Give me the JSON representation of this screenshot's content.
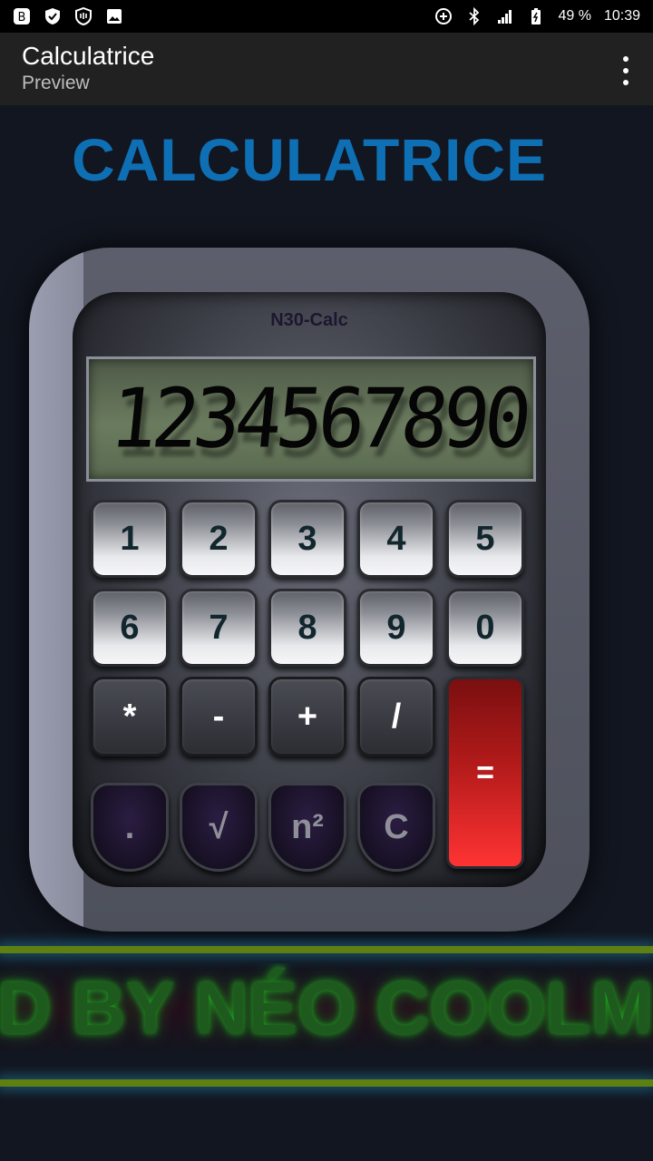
{
  "status_bar": {
    "left_icons": [
      "bitcoin-icon",
      "shield-icon",
      "vpn-shield-icon",
      "image-icon"
    ],
    "right_icons": [
      "data-saver-icon",
      "bluetooth-icon",
      "signal-icon",
      "battery-icon"
    ],
    "battery": "49 %",
    "time": "10:39"
  },
  "app_bar": {
    "title": "Calculatrice",
    "subtitle": "Preview",
    "menu_icon": "more-vert-icon"
  },
  "heading": "CALCULATRICE",
  "calculator": {
    "brand": "N30-Calc",
    "display": "1234567890",
    "keys_row1": [
      "1",
      "2",
      "3",
      "4",
      "5"
    ],
    "keys_row2": [
      "6",
      "7",
      "8",
      "9",
      "0"
    ],
    "keys_row3": [
      "*",
      "-",
      "+",
      "/"
    ],
    "keys_row4": [
      ".",
      "√",
      "n²",
      "C"
    ],
    "equals": "="
  },
  "marquee": "ED BY NÉO COOLM",
  "colors": {
    "heading": "#0f6fb4",
    "equals_key": "#e32222",
    "marquee_text": "#1fa51f",
    "neon_line": "#5e7f12"
  }
}
